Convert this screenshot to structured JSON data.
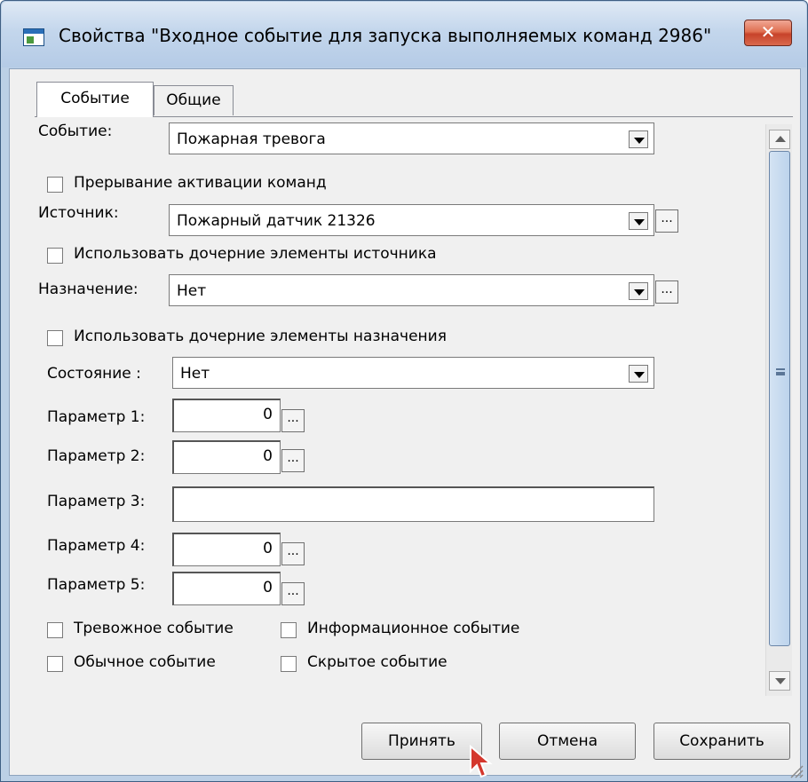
{
  "window": {
    "title": "Свойства  \"Входное событие для запуска выполняемых команд 2986\"",
    "close_label": "✕"
  },
  "tabs": [
    {
      "label": "Событие",
      "active": true
    },
    {
      "label": "Общие",
      "active": false
    }
  ],
  "form": {
    "event_label": "Событие:",
    "event_value": "Пожарная тревога",
    "interrupt_label": "Прерывание активации команд",
    "interrupt_checked": false,
    "source_label": "Источник:",
    "source_value": "Пожарный датчик 21326",
    "use_source_children_label": "Использовать дочерние элементы источника",
    "use_source_children_checked": false,
    "destination_label": "Назначение:",
    "destination_value": "Нет",
    "use_dest_children_label": "Использовать дочерние элементы назначения",
    "use_dest_children_checked": false,
    "state_label": "Состояние :",
    "state_value": "Нет",
    "param1_label": "Параметр 1:",
    "param1_value": "0",
    "param2_label": "Параметр 2:",
    "param2_value": "0",
    "param3_label": "Параметр 3:",
    "param3_value": "",
    "param4_label": "Параметр 4:",
    "param4_value": "0",
    "param5_label": "Параметр 5:",
    "param5_value": "0",
    "alarm_event_label": "Тревожное событие",
    "info_event_label": "Информационное событие",
    "normal_event_label": "Обычное событие",
    "hidden_event_label": "Скрытое событие",
    "dots_label": "..."
  },
  "buttons": {
    "accept": "Принять",
    "cancel": "Отмена",
    "save": "Сохранить"
  },
  "colors": {
    "title_gradient_top": "#dfe9f5",
    "close_button": "#c7432a",
    "dialog_bg": "#f0f0f0"
  }
}
